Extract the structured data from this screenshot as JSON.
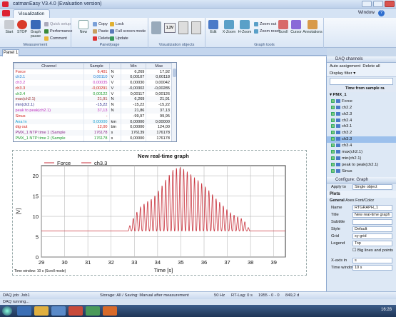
{
  "window": {
    "title": "catmanEasy V3.4.0 (Evaluation version)"
  },
  "ribbon": {
    "tab": "Visualization",
    "window_menu": "Window",
    "groups": {
      "measurement": "Measurement",
      "panel_page": "Panel/page",
      "viz_objects": "Visualization objects",
      "graph_tools": "Graph tools"
    },
    "buttons": {
      "start": "Start",
      "stop": "STOP",
      "graph_pause": "Graph pause",
      "new": "New",
      "edit": "Edit",
      "xzoom": "X-Zoom",
      "hzoom": "H-Zoom",
      "scroll": "Scroll",
      "cursor": "Cursor",
      "annotations": "Annotations",
      "quick_setup": "Quick setup",
      "performance": "Performance",
      "comment": "Comment",
      "copy": "Copy",
      "paste": "Paste",
      "delete": "Delete",
      "lock": "Lock",
      "full_screen": "Full screen mode",
      "update": "Update",
      "zoom_out": "Zoom out",
      "zoom_reset": "Zoom reset"
    }
  },
  "page_tab": "Panel 1",
  "channel_table": {
    "headers": [
      "Channel",
      "Sample",
      "",
      "Min",
      "Max"
    ],
    "rows": [
      {
        "name": "Force",
        "sample": "6,401",
        "unit": "N",
        "min": "6,269",
        "max": "17,92",
        "color": "#d0201a"
      },
      {
        "name": "ch3.1",
        "sample": "0,00110",
        "unit": "V",
        "min": "0,00107",
        "max": "0,00118",
        "color": "#1a7fd4"
      },
      {
        "name": "ch3.2",
        "sample": "0,00035",
        "unit": "V",
        "min": "0,00030",
        "max": "0,00042",
        "color": "#c030c0"
      },
      {
        "name": "ch3.3",
        "sample": "-0,00291",
        "unit": "V",
        "min": "-0,00302",
        "max": "-0,00285",
        "color": "#d0201a"
      },
      {
        "name": "ch3.4",
        "sample": "0,00122",
        "unit": "V",
        "min": "0,00117",
        "max": "0,00126",
        "color": "#1a9a2a"
      },
      {
        "name": "max(ch2.1)",
        "sample": "21,91",
        "unit": "N",
        "min": "6,269",
        "max": "21,91",
        "color": "#9a2a2a"
      },
      {
        "name": "min(ch2.1)",
        "sample": "-15,22",
        "unit": "N",
        "min": "-15,22",
        "max": "-15,22",
        "color": "#2a2a8a"
      },
      {
        "name": "peak to peak(ch2.1)",
        "sample": "37,13",
        "unit": "N",
        "min": "21,86",
        "max": "37,13",
        "color": "#c030c0"
      },
      {
        "name": "Sinus",
        "sample": "-",
        "unit": "",
        "min": "-99,97",
        "max": "99,95",
        "color": "#d0201a"
      },
      {
        "name": "Ana In",
        "sample": "0,00000",
        "unit": "km",
        "min": "0,00000",
        "max": "0,00000",
        "color": "#1aa0d0"
      },
      {
        "name": "dig out",
        "sample": "12,00",
        "unit": "bin",
        "min": "0,00000",
        "max": "124,00",
        "color": "#d0201a"
      },
      {
        "name": "PMX_1 NTP time 1 (Sample",
        "sample": "176178",
        "unit": "s",
        "min": "176139",
        "max": "176178",
        "color": "#8a2a8a"
      },
      {
        "name": "PMX_1 NTP time 2 (Sample",
        "sample": "176178",
        "unit": "s",
        "min": "0,00000",
        "max": "176178",
        "color": "#1a9a2a"
      },
      {
        "name": "PMX_1 NTP time 3 (Sample",
        "sample": "176178",
        "unit": "s",
        "min": "176139",
        "max": "176178",
        "color": "#c030c0"
      }
    ]
  },
  "chart_data": {
    "type": "line",
    "title": "New real-time graph",
    "xlabel": "Time [s]",
    "ylabel": "[V]",
    "xlim": [
      29,
      39.5
    ],
    "ylim": [
      0,
      22.5
    ],
    "xticks": [
      29,
      30,
      31,
      32,
      33,
      34,
      35,
      36,
      37,
      38,
      39
    ],
    "yticks": [
      0,
      5,
      10,
      15,
      20
    ],
    "grid": true,
    "legend_position": "top-left",
    "series": [
      {
        "name": "Force",
        "color": "#c8323c",
        "style": "solid"
      },
      {
        "name": "ch3.3",
        "color": "#c8323c",
        "style": "solid"
      }
    ],
    "x": [
      29.0,
      32.7,
      32.9,
      33.2,
      33.5,
      33.8,
      34.1,
      34.4,
      34.7,
      35.0,
      35.3,
      35.6,
      35.9,
      36.2,
      36.5,
      36.8,
      37.1,
      37.4,
      37.7,
      38.0,
      38.3,
      39.5
    ],
    "envelope_peak": [
      6.4,
      6.4,
      9.0,
      12.0,
      13.5,
      14.5,
      16.8,
      19.5,
      21.8,
      22.2,
      21.0,
      19.6,
      18.2,
      16.5,
      14.5,
      12.8,
      11.0,
      10.0,
      9.2,
      6.4,
      6.4,
      6.4
    ],
    "baseline": 6.4,
    "time_window": "Time window: 10 s (Scroll mode)"
  },
  "right_panel": {
    "daq_title": "DAQ channels",
    "auto_assignment": "Auto assignment",
    "delete_all": "Delete all",
    "display_filter": "Display filter",
    "col_header": "Time from sample ra",
    "group": "PMX_1",
    "items": [
      "Force",
      "ch2.2",
      "ch2.3",
      "ch2.4",
      "ch3.1",
      "ch3.2",
      "ch3.3",
      "ch3.4",
      "max(ch2.1)",
      "min(ch2.1)",
      "peak to peak(ch2.1)",
      "Sinus"
    ],
    "selected_index": 6,
    "configure_title": "Configure: Graph",
    "apply_to_label": "Apply to",
    "apply_to_value": "Single object",
    "plots_label": "Plots",
    "tabs": [
      "General",
      "Axes",
      "Font/Color"
    ],
    "props": [
      {
        "label": "Name",
        "value": "RTGRAPH_1"
      },
      {
        "label": "Title",
        "value": "New real-time graph"
      },
      {
        "label": "Subtitle",
        "value": ""
      },
      {
        "label": "Style",
        "value": "Default"
      },
      {
        "label": "Grid",
        "value": "xy-grid"
      },
      {
        "label": "Legend",
        "value": "Top"
      }
    ],
    "big_lines": "Big lines and points",
    "xaxis_label": "X-axis in",
    "xaxis_value": "s",
    "timewin_label": "Time window",
    "timewin_value": "10 s"
  },
  "status": {
    "daq_job": "DAQ job: Job1",
    "storage": "Storage: All / Saving: Manual after measurement",
    "rate": "50 Hz",
    "rt_lag": "RT-Lag: 0 s",
    "count": "1955 - 0 - 0",
    "memory": "849,2 d",
    "running": "DAQ running..."
  },
  "taskbar": {
    "clock": "16:28"
  }
}
